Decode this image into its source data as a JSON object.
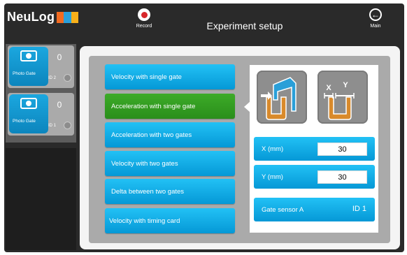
{
  "app": {
    "logo_text": "NeuLog",
    "logo_colors": [
      "#f26b21",
      "#2aa0dc",
      "#f7b01a"
    ]
  },
  "header": {
    "record_label": "Record",
    "record_icon": "record-icon",
    "title": "Experiment setup",
    "main_label": "Main",
    "main_icon": "back-arrow-icon",
    "main_glyph": "←"
  },
  "sensors": [
    {
      "name": "Photo Gate",
      "value": "0",
      "id_label": "ID 2",
      "icon": "eye-icon"
    },
    {
      "name": "Photo Gate",
      "value": "0",
      "id_label": "ID 1",
      "icon": "eye-icon"
    }
  ],
  "experiments": [
    {
      "label": "Velocity with single gate",
      "selected": false
    },
    {
      "label": "Acceleration with single gate",
      "selected": true
    },
    {
      "label": "Acceleration with two gates",
      "selected": false
    },
    {
      "label": "Velocity with two gates",
      "selected": false
    },
    {
      "label": "Delta between two gates",
      "selected": false
    },
    {
      "label": "Velocity with timing card",
      "selected": false
    }
  ],
  "settings": {
    "modes": [
      {
        "icon": "photo-gate-flag-icon",
        "selected": true
      },
      {
        "icon": "photo-gate-xy-icon",
        "selected": false,
        "label_x": "X",
        "label_y": "Y"
      }
    ],
    "x_label": "X (mm)",
    "x_value": "30",
    "y_label": "Y (mm)",
    "y_value": "30",
    "gate_label": "Gate sensor A",
    "gate_value": "ID 1"
  },
  "colors": {
    "button_blue": "#0ea9e6",
    "selected_green": "#35a023",
    "record_red": "#d8272a",
    "gate_orange": "#d98a2b"
  }
}
